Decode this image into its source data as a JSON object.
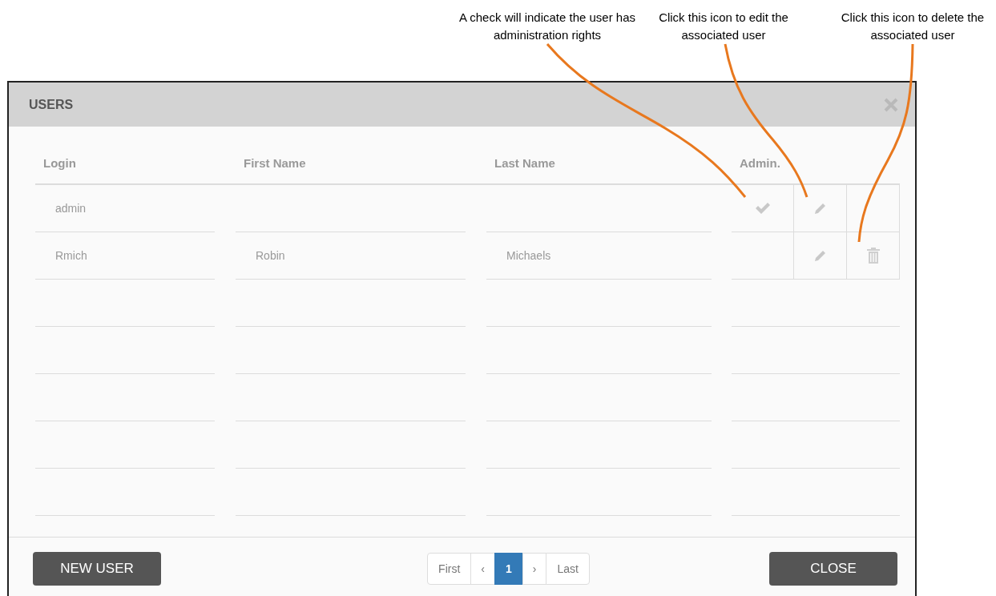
{
  "annotations": [
    {
      "text": "A check will indicate the user has administration rights"
    },
    {
      "text": "Click this icon to edit the associated user"
    },
    {
      "text": "Click this icon to delete the associated user"
    }
  ],
  "dialog": {
    "title": "USERS",
    "columns": [
      "Login",
      "First Name",
      "Last Name",
      "Admin."
    ],
    "rows": [
      {
        "login": "admin",
        "admin": true,
        "deletable": false
      },
      {
        "login": "Rmich",
        "first_name": "Robin",
        "last_name": "Michaels",
        "admin": false,
        "deletable": true
      }
    ],
    "buttons": {
      "new": "NEW USER",
      "close": "CLOSE"
    },
    "pagination": [
      {
        "kind": "first",
        "label": "First",
        "selected": false
      },
      {
        "kind": "prev",
        "label": "‹",
        "selected": false
      },
      {
        "kind": "page",
        "label": "1",
        "selected": true
      },
      {
        "kind": "next",
        "label": "›",
        "selected": false
      },
      {
        "kind": "last",
        "label": "Last",
        "selected": false
      }
    ]
  }
}
